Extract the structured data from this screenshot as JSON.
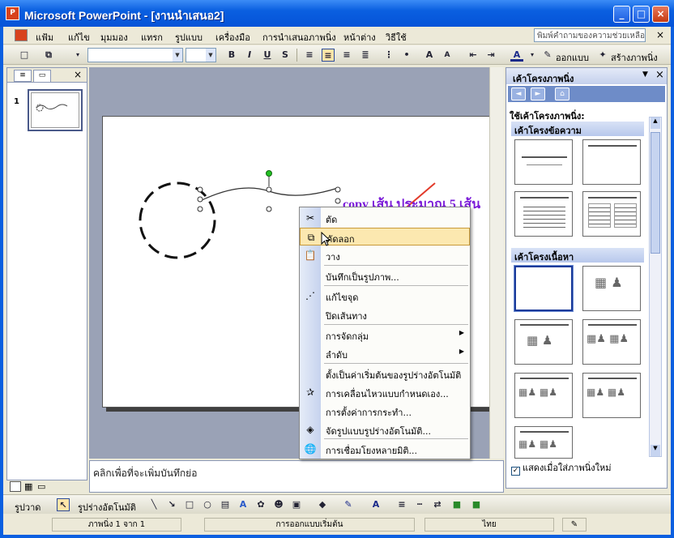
{
  "window": {
    "title": "Microsoft PowerPoint - [งานนำเสนอ2]",
    "app_icon": "P"
  },
  "menu": [
    "แฟ้ม",
    "แก้ไข",
    "มุมมอง",
    "แทรก",
    "รูปแบบ",
    "เครื่องมือ",
    "การนำเสนอภาพนิ่ง",
    "หน้าต่าง",
    "วิธีใช้"
  ],
  "help_box": {
    "placeholder": "พิมพ์คำถามของความช่วยเหลือ"
  },
  "toolbar": {
    "design_label": "ออกแบบ",
    "new_slide_label": "สร้างภาพนิ่ง"
  },
  "slide_panel": {
    "slide_number": "1"
  },
  "slide": {
    "annotation": "copy เส้น ประมาณ 5 เส้น"
  },
  "notes": {
    "placeholder": "คลิกเพื่อที่จะเพิ่มบันทึกย่อ"
  },
  "task_pane": {
    "title": "เค้าโครงภาพนิ่ง",
    "subtitle": "ใช้เค้าโครงภาพนิ่ง:",
    "section_text": "เค้าโครงข้อความ",
    "section_content": "เค้าโครงเนื้อหา",
    "show_on_insert": "แสดงเมื่อใส่ภาพนิ่งใหม่"
  },
  "context_menu": [
    {
      "label": "ตัด",
      "icon": "scissors-icon"
    },
    {
      "label": "คัดลอก",
      "icon": "copy-icon"
    },
    {
      "label": "วาง",
      "icon": "paste-icon"
    },
    {
      "label": "บันทึกเป็นรูปภาพ...",
      "icon": ""
    },
    {
      "label": "แก้ไขจุด",
      "icon": "edit-points-icon"
    },
    {
      "label": "ปิดเส้นทาง",
      "icon": ""
    },
    {
      "label": "การจัดกลุ่ม",
      "icon": ""
    },
    {
      "label": "ลำดับ",
      "icon": ""
    },
    {
      "label": "ตั้งเป็นค่าเริ่มต้นของรูปร่างอัตโนมัติ",
      "icon": ""
    },
    {
      "label": "การเคลื่อนไหวแบบกำหนดเอง...",
      "icon": "animation-icon"
    },
    {
      "label": "การตั้งค่าการกระทำ...",
      "icon": ""
    },
    {
      "label": "จัดรูปแบบรูปร่างอัตโนมัติ...",
      "icon": "format-shape-icon"
    },
    {
      "label": "การเชื่อมโยงหลายมิติ...",
      "icon": "hyperlink-icon"
    }
  ],
  "drawing_toolbar": {
    "draw_label": "รูปวาด",
    "autoshapes_label": "รูปร่างอัตโนมัติ"
  },
  "status": {
    "slide": "ภาพนิ่ง 1 จาก 1",
    "design": "การออกแบบเริ่มต้น",
    "language": "ไทย"
  }
}
